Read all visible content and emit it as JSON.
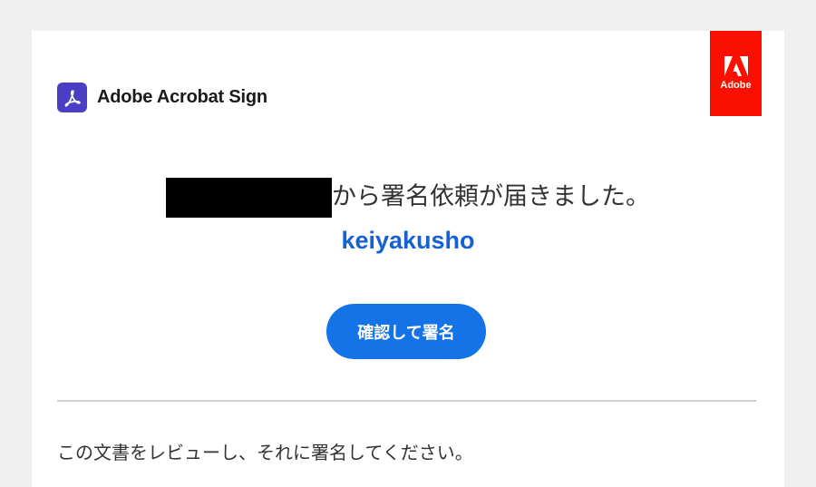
{
  "brand": {
    "name": "Adobe Acrobat Sign",
    "icon": "acrobat-sign-icon",
    "icon_color": "#4b3ec4"
  },
  "adobe_logo": {
    "label": "Adobe",
    "color": "#fa0f00"
  },
  "message": {
    "sender_redacted": true,
    "headline": "から署名依頼が届きました。",
    "document_name": "keiyakusho"
  },
  "action": {
    "button_label": "確認して署名",
    "button_color": "#1473e6"
  },
  "body": {
    "instruction": "この文書をレビューし、それに署名してください。"
  },
  "colors": {
    "link": "#1560d4",
    "background": "#f0f0f0",
    "card": "#ffffff"
  }
}
